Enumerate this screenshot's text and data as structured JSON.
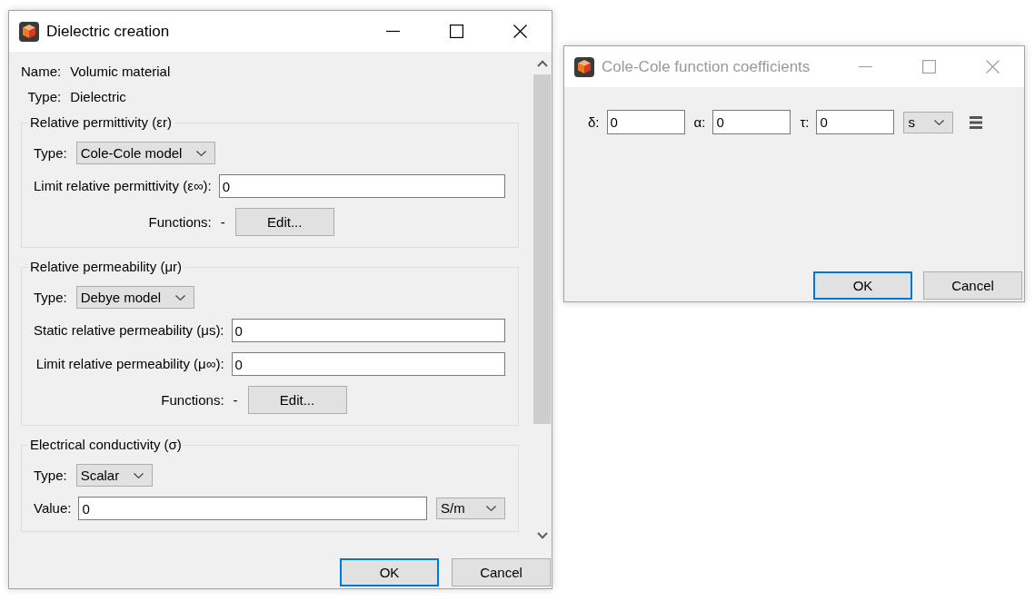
{
  "dialogs": [
    {
      "kind": "material",
      "title": "Dielectric creation",
      "active": true,
      "info": [
        {
          "label": "Name:",
          "value": "Volumic material"
        },
        {
          "label": "Type:",
          "value": "Dielectric"
        }
      ],
      "groups": [
        {
          "title": "Relative permittivity (εr)",
          "rows": [
            {
              "kind": "dropdown",
              "label": "Type:",
              "value": "Cole-Cole model"
            },
            {
              "kind": "field",
              "label": "Limit relative permittivity (ε∞):",
              "value": "0"
            },
            {
              "kind": "functions",
              "label": "Functions:",
              "summary": "-",
              "button": "Edit..."
            }
          ]
        },
        {
          "title": "Relative permeability (μr)",
          "rows": [
            {
              "kind": "dropdown",
              "label": "Type:",
              "value": "Debye model"
            },
            {
              "kind": "field",
              "label": "Static relative permeability (μs):",
              "value": "0"
            },
            {
              "kind": "field",
              "label": "Limit relative permeability (μ∞):",
              "value": "0"
            },
            {
              "kind": "functions",
              "label": "Functions:",
              "summary": "-",
              "button": "Edit..."
            }
          ]
        },
        {
          "title": "Electrical conductivity (σ)",
          "rows": [
            {
              "kind": "dropdown",
              "label": "Type:",
              "value": "Scalar"
            },
            {
              "kind": "field",
              "label": "Value:",
              "value": "0",
              "unit": "S/m"
            }
          ]
        }
      ],
      "buttons": [
        {
          "label": "OK",
          "default": true
        },
        {
          "label": "Cancel",
          "default": false
        }
      ]
    },
    {
      "kind": "coefficients",
      "title": "Cole-Cole function coefficients",
      "active": false,
      "coefficients": [
        {
          "label": "δ:",
          "value": "0"
        },
        {
          "label": "α:",
          "value": "0"
        },
        {
          "label": "τ:",
          "value": "0"
        }
      ],
      "unit": "s",
      "buttons": [
        {
          "label": "OK",
          "default": true
        },
        {
          "label": "Cancel",
          "default": false
        }
      ]
    }
  ]
}
